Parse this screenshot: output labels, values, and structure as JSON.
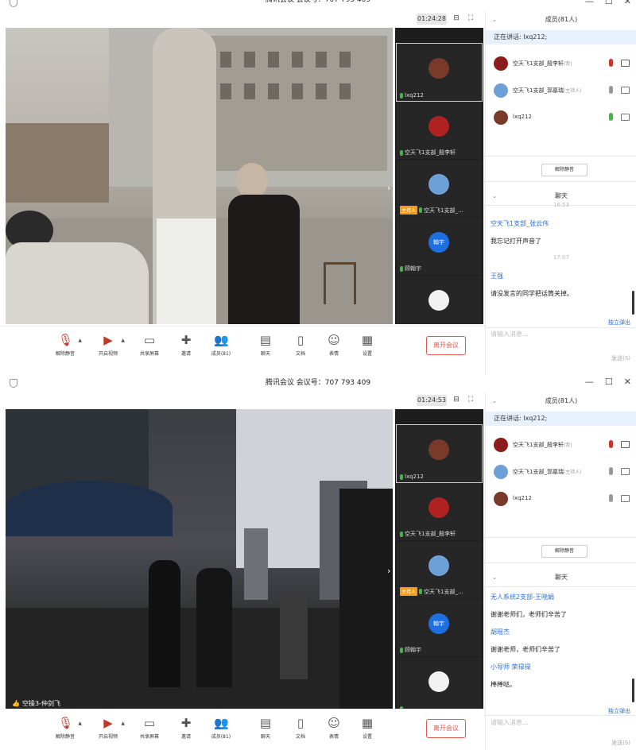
{
  "windows": [
    {
      "title": "腾讯会议 会议号：707 793 409",
      "timer": "01:24:28",
      "video_label": "",
      "thumbnails": [
        {
          "name": "lxq212",
          "mic": "on",
          "host": ""
        },
        {
          "name": "空天飞1支部_殷李轩",
          "mic": "on",
          "host": ""
        },
        {
          "name": "空天飞1支部_...",
          "mic": "on",
          "host": "主持人"
        },
        {
          "name": "顾翰宇",
          "mic": "on",
          "host": "",
          "avatar_text": "翰宇"
        },
        {
          "name": "",
          "mic": "on",
          "host": ""
        }
      ],
      "toolbar": [
        "解除静音",
        "开启视频",
        "共享屏幕",
        "邀请",
        "成员(81)",
        "聊天",
        "文档",
        "表情",
        "设置"
      ],
      "leave": "离开会议",
      "members_title": "成员(81人)",
      "speaking": "正在讲话: lxq212;",
      "members": [
        {
          "name": "空天飞1支部_殷李轩",
          "tag": "(我)",
          "mic": "red",
          "cam": "red"
        },
        {
          "name": "空天飞1支部_郭墓瑞",
          "tag": "(主持人)",
          "mic": "grey",
          "cam": "grey"
        },
        {
          "name": "lxq212",
          "tag": "",
          "mic": "green",
          "cam": "grey"
        }
      ],
      "unmute_all": "解除静音",
      "chat_title": "聊天",
      "chat": [
        {
          "kind": "time",
          "text": "16:53"
        },
        {
          "kind": "sender",
          "text": "空天飞1支部_张云伟"
        },
        {
          "kind": "msg",
          "text": "我忘记打开声音了"
        },
        {
          "kind": "time",
          "text": "17:07"
        },
        {
          "kind": "sender",
          "text": "王强"
        },
        {
          "kind": "msg",
          "text": "请没发言的同学把话筒关掉。"
        }
      ],
      "popout": "独立弹出",
      "input_placeholder": "请输入消息...",
      "send": "发送(S)"
    },
    {
      "title": "腾讯会议 会议号：707 793 409",
      "timer": "01:24:53",
      "video_label": "空操3-仲剑飞",
      "thumbnails": [
        {
          "name": "lxq212",
          "mic": "on",
          "host": ""
        },
        {
          "name": "空天飞1支部_殷李轩",
          "mic": "on",
          "host": ""
        },
        {
          "name": "空天飞1支部_...",
          "mic": "on",
          "host": "主持人"
        },
        {
          "name": "顾翰宇",
          "mic": "on",
          "host": "",
          "avatar_text": "翰宇"
        },
        {
          "name": "",
          "mic": "on",
          "host": ""
        }
      ],
      "toolbar": [
        "解除静音",
        "开启视频",
        "共享屏幕",
        "邀请",
        "成员(81)",
        "聊天",
        "文档",
        "表情",
        "设置"
      ],
      "leave": "离开会议",
      "members_title": "成员(81人)",
      "speaking": "正在讲话: lxq212;",
      "members": [
        {
          "name": "空天飞1支部_殷李轩",
          "tag": "(我)",
          "mic": "red",
          "cam": "red"
        },
        {
          "name": "空天飞1支部_郭墓瑞",
          "tag": "(主持人)",
          "mic": "grey",
          "cam": "grey"
        },
        {
          "name": "lxq212",
          "tag": "",
          "mic": "grey",
          "cam": "grey"
        }
      ],
      "unmute_all": "解除静音",
      "chat_title": "聊天",
      "chat": [
        {
          "kind": "sender",
          "text": "无人系统2支部-王晓娟"
        },
        {
          "kind": "msg",
          "text": "谢谢老师们，老师们辛苦了"
        },
        {
          "kind": "sender",
          "text": "胡瑶杰"
        },
        {
          "kind": "msg",
          "text": "谢谢老师，老师们辛苦了"
        },
        {
          "kind": "sender",
          "text": "小导师 荣禄禄"
        },
        {
          "kind": "msg",
          "text": "棒棒哒。"
        }
      ],
      "popout": "独立弹出",
      "input_placeholder": "请输入消息...",
      "send": "发送(S)"
    }
  ],
  "colors": {
    "accent": "#2b6fd6",
    "leave": "#e05a4f",
    "speaking_bg": "#e6f1fc",
    "host_tag": "#f29c1f"
  },
  "icons": {
    "mute": "mic-off-icon",
    "video": "camera-off-icon",
    "share": "screen-share-icon",
    "invite": "add-person-icon",
    "members": "people-icon",
    "chat": "chat-bubble-icon",
    "docs": "document-icon",
    "emoji": "smiley-icon",
    "settings": "grid-icon"
  }
}
